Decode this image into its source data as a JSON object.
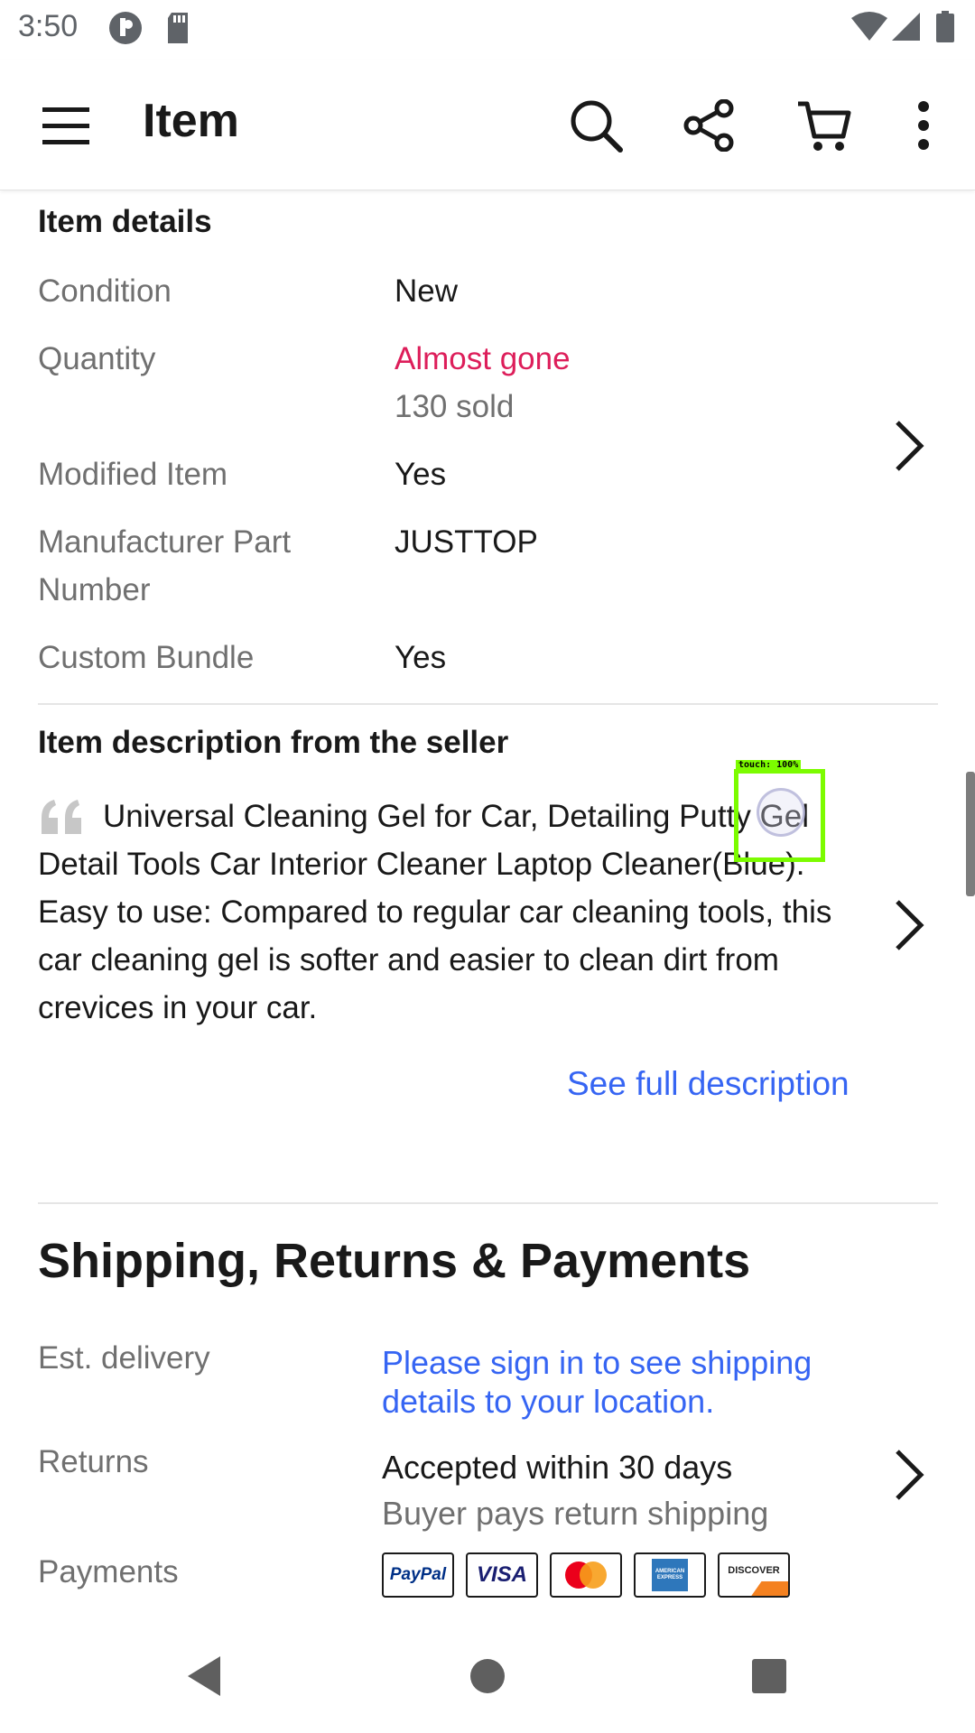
{
  "status_bar": {
    "time": "3:50"
  },
  "app_bar": {
    "title": "Item"
  },
  "item_details": {
    "heading": "Item details",
    "rows": [
      {
        "label": "Condition",
        "value": "New"
      },
      {
        "label": "Quantity",
        "value": "Almost gone",
        "sub": "130 sold"
      },
      {
        "label": "Modified Item",
        "value": "Yes"
      },
      {
        "label": "Manufacturer Part",
        "label2": "Number",
        "value": "JUSTTOP"
      },
      {
        "label": "Custom Bundle",
        "value": "Yes"
      }
    ]
  },
  "description": {
    "heading": "Item description from the seller",
    "text": "Universal Cleaning Gel for Car, Detailing Putty Gel Detail Tools Car Interior Cleaner Laptop Cleaner(Blue). Easy to use: Compared to regular car cleaning tools, this car cleaning gel is softer and easier to clean dirt from crevices in your car.",
    "see_full": "See full description"
  },
  "shipping": {
    "heading": "Shipping, Returns & Payments",
    "delivery_label": "Est. delivery",
    "delivery_value_line1": "Please sign in to see shipping",
    "delivery_value_line2": "details to your location.",
    "returns_label": "Returns",
    "returns_value": "Accepted within 30 days",
    "returns_sub": "Buyer pays return shipping",
    "payments_label": "Payments",
    "payment_methods": [
      "PayPal",
      "VISA",
      "Mastercard",
      "AMERICAN EXPRESS",
      "DISCOVER"
    ]
  },
  "touch_indicator": {
    "label": "touch: 100%"
  },
  "colors": {
    "accent_link": "#3665f3",
    "almost_gone": "#dd1e5a",
    "label_gray": "#707070",
    "touch_box": "#7cfc00"
  },
  "icons": {
    "menu": "menu-icon",
    "search": "search-icon",
    "share": "share-icon",
    "cart": "cart-icon",
    "more": "more-vert-icon",
    "chevron": "chevron-right-icon",
    "quote": "quote-icon",
    "back": "back-icon",
    "home": "home-icon",
    "recents": "recents-icon"
  }
}
